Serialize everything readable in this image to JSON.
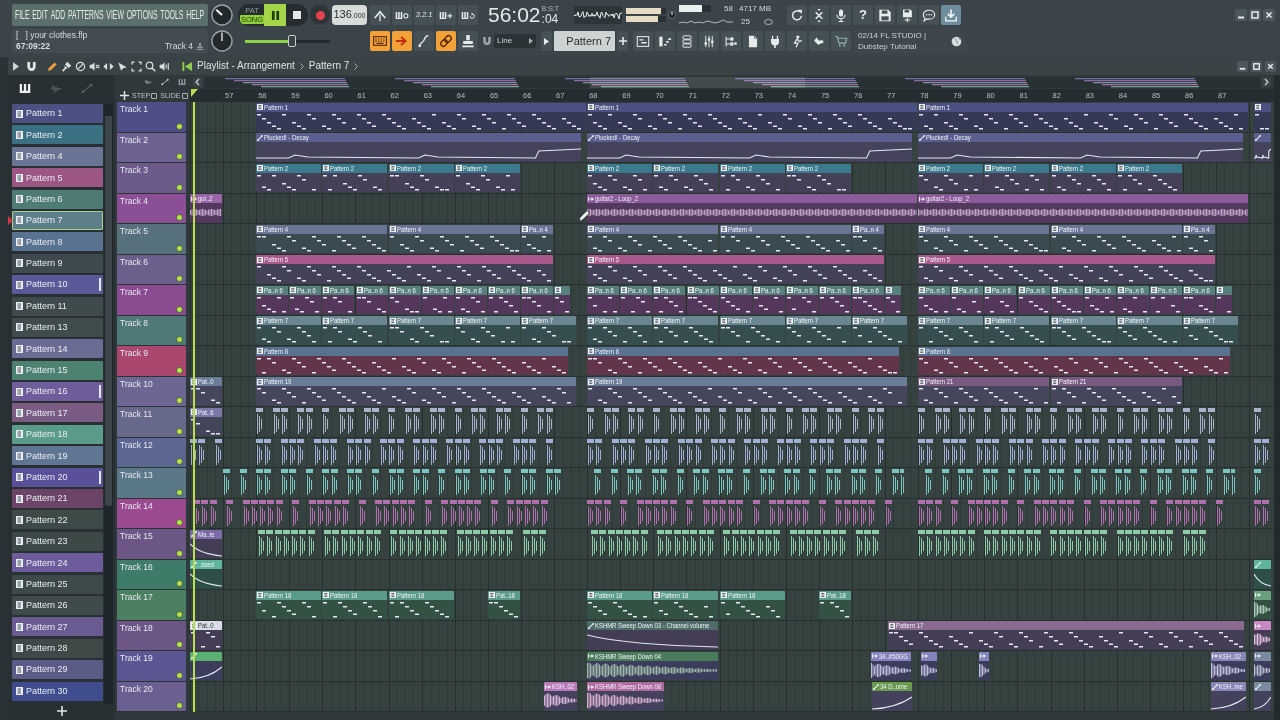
{
  "menu": [
    "FILE",
    "EDIT",
    "ADD",
    "PATTERNS",
    "VIEW",
    "OPTIONS",
    "TOOLS",
    "HELP"
  ],
  "hint": {
    "project": "[   ] your clothes.flp",
    "time": "67:09:22",
    "target": "Track 4"
  },
  "transport": {
    "modes": [
      {
        "label": "PAT",
        "selected": false
      },
      {
        "label": "SONG",
        "selected": true
      }
    ],
    "playing": true,
    "tempo": "136",
    "tempo_fraction": ".000",
    "countdown": "3.2.1"
  },
  "song_position": {
    "time": "56:02",
    "ticks": ":04",
    "unit": "B:S:T"
  },
  "peak_meters": [
    {
      "level": 0.88
    },
    {
      "level": 0.8
    }
  ],
  "cpu": {
    "level": 0.72,
    "value": "58",
    "memory": "4717 MB",
    "polyphony": "25"
  },
  "help": "?",
  "master": {
    "level": 0.55
  },
  "toggles": [
    {
      "on": true
    },
    {
      "on": true
    },
    {
      "on": false
    },
    {
      "on": true
    },
    {
      "on": false
    }
  ],
  "snap": "Line",
  "pattern_selector": "Pattern 7",
  "news": {
    "line_1": "02/14 FL STUDIO |",
    "line_2": "Dubstep Tutorial"
  },
  "playlist": {
    "title": "Playlist - Arrangement",
    "crumb": "Pattern 7",
    "tools": [
      {
        "selected": true
      },
      {
        "selected": false
      },
      {
        "selected": false
      },
      {
        "selected": false
      },
      {
        "selected": false
      },
      {
        "selected": false
      },
      {
        "selected": false
      },
      {
        "selected": false
      },
      {
        "selected": false
      }
    ],
    "options": [
      {
        "label": "STEP",
        "checked": false
      },
      {
        "label": "SLIDE",
        "checked": false
      }
    ]
  },
  "ruler": [
    "57",
    "58",
    "59",
    "60",
    "61",
    "62",
    "63",
    "64",
    "65",
    "66",
    "67",
    "68",
    "69",
    "70",
    "71",
    "72",
    "73",
    "74",
    "75",
    "76",
    "77",
    "78",
    "79",
    "80",
    "81",
    "82",
    "83",
    "84",
    "85",
    "86",
    "87"
  ],
  "patterns": [
    {
      "name": "Pattern 1",
      "color": "#4b5183",
      "selected": false,
      "marked": false
    },
    {
      "name": "Pattern 2",
      "color": "#3a7082",
      "selected": false,
      "marked": false
    },
    {
      "name": "Pattern 4",
      "color": "#6a7596",
      "selected": false,
      "marked": false
    },
    {
      "name": "Pattern 5",
      "color": "#9b5683",
      "selected": false,
      "marked": false
    },
    {
      "name": "Pattern 6",
      "color": "#4f7b76",
      "selected": false,
      "marked": false
    },
    {
      "name": "Pattern 7",
      "color": "#5d7f89",
      "selected": true,
      "marked": false
    },
    {
      "name": "Pattern 8",
      "color": "#587290",
      "selected": false,
      "marked": false
    },
    {
      "name": "Pattern 9",
      "color": "#3e4a4d",
      "selected": false,
      "marked": false
    },
    {
      "name": "Pattern 10",
      "color": "#5a5a98",
      "selected": false,
      "marked": true
    },
    {
      "name": "Pattern 11",
      "color": "#3e4a4b",
      "selected": false,
      "marked": false
    },
    {
      "name": "Pattern 13",
      "color": "#3f4b4c",
      "selected": false,
      "marked": false
    },
    {
      "name": "Pattern 14",
      "color": "#6a6c94",
      "selected": false,
      "marked": false
    },
    {
      "name": "Pattern 15",
      "color": "#4d8270",
      "selected": false,
      "marked": false
    },
    {
      "name": "Pattern 16",
      "color": "#6f5c9a",
      "selected": false,
      "marked": true
    },
    {
      "name": "Pattern 17",
      "color": "#7a5b82",
      "selected": false,
      "marked": false
    },
    {
      "name": "Pattern 18",
      "color": "#5a9b8a",
      "selected": false,
      "marked": false
    },
    {
      "name": "Pattern 19",
      "color": "#607593",
      "selected": false,
      "marked": false
    },
    {
      "name": "Pattern 20",
      "color": "#5a4f99",
      "selected": false,
      "marked": true
    },
    {
      "name": "Pattern 21",
      "color": "#6b4468",
      "selected": false,
      "marked": false
    },
    {
      "name": "Pattern 22",
      "color": "#3e4a48",
      "selected": false,
      "marked": false
    },
    {
      "name": "Pattern 23",
      "color": "#3d4947",
      "selected": false,
      "marked": false
    },
    {
      "name": "Pattern 24",
      "color": "#6c5c9c",
      "selected": false,
      "marked": false
    },
    {
      "name": "Pattern 25",
      "color": "#3e4a49",
      "selected": false,
      "marked": false
    },
    {
      "name": "Pattern 26",
      "color": "#3f4a4a",
      "selected": false,
      "marked": false
    },
    {
      "name": "Pattern 27",
      "color": "#6a5b92",
      "selected": false,
      "marked": false
    },
    {
      "name": "Pattern 28",
      "color": "#3e4948",
      "selected": false,
      "marked": false
    },
    {
      "name": "Pattern 29",
      "color": "#5b5b88",
      "selected": false,
      "marked": false
    },
    {
      "name": "Pattern 30",
      "color": "#3f4d8e",
      "selected": false,
      "marked": false
    }
  ],
  "tracks": [
    {
      "name": "Track 1",
      "color": "#4d4f86",
      "enabled": true,
      "clips": [
        {
          "kind": "pattern",
          "label": "Pattern 1",
          "color": "#4b5183"
        },
        {
          "kind": "pattern",
          "label": "Pattern 1",
          "color": "#4b5183"
        },
        {
          "kind": "pattern",
          "label": "Pattern 1",
          "color": "#4b5183"
        },
        {
          "kind": "pattern",
          "color": "#4b5183"
        }
      ]
    },
    {
      "name": "Track 2",
      "color": "#6d6292",
      "enabled": true,
      "clips": [
        {
          "kind": "automation",
          "label": "Plucked! - Decay",
          "color": "#5b5f8f"
        },
        {
          "kind": "automation",
          "label": "Plucked! - Decay",
          "color": "#5b5f8f"
        },
        {
          "kind": "automation",
          "label": "Plucked! - Decay",
          "color": "#5b5f8f"
        },
        {
          "kind": "automation",
          "color": "#5b5f8f"
        }
      ]
    },
    {
      "name": "Track 3",
      "color": "#6c5a8a",
      "enabled": true,
      "clips": [
        {
          "kind": "pattern",
          "label": "Pattern 2",
          "color": "#3a7a8c"
        },
        {
          "kind": "pattern",
          "label": "Pattern 2",
          "color": "#3a7a8c"
        },
        {
          "kind": "pattern",
          "label": "Pattern 2",
          "color": "#3a7a8c"
        },
        {
          "kind": "pattern",
          "label": "Pattern 2",
          "color": "#3a7a8c"
        },
        {
          "kind": "pattern",
          "label": "Pattern 2",
          "color": "#3a7a8c"
        },
        {
          "kind": "pattern",
          "label": "Pattern 2",
          "color": "#3a7a8c"
        },
        {
          "kind": "pattern",
          "label": "Pattern 2",
          "color": "#3a7a8c"
        },
        {
          "kind": "pattern",
          "label": "Pattern 2",
          "color": "#3a7a8c"
        },
        {
          "kind": "pattern",
          "label": "Pattern 2",
          "color": "#3a7a8c"
        },
        {
          "kind": "pattern",
          "label": "Pattern 2",
          "color": "#3a7a8c"
        },
        {
          "kind": "pattern",
          "label": "Pattern 2",
          "color": "#3a7a8c"
        },
        {
          "kind": "pattern",
          "label": "Pattern 2",
          "color": "#3a7a8c"
        }
      ]
    },
    {
      "name": "Track 4",
      "color": "#8b4f96",
      "enabled": true,
      "clips": [
        {
          "kind": "audio",
          "label": "gui..2",
          "color": "#9a64a8"
        },
        {
          "kind": "audio",
          "label": "guitar2 - Loop_2",
          "color": "#8a5a9a"
        },
        {
          "kind": "audio",
          "label": "guitar2 - Loop_2",
          "color": "#8a5a9a"
        }
      ]
    },
    {
      "name": "Track 5",
      "color": "#56717b",
      "enabled": true,
      "clips": [
        {
          "kind": "pattern",
          "label": "Pattern 4",
          "color": "#6a7596"
        },
        {
          "kind": "pattern",
          "label": "Pattern 4",
          "color": "#6a7596"
        },
        {
          "kind": "pattern",
          "label": "Pa..n 4",
          "color": "#6a7596"
        },
        {
          "kind": "pattern",
          "label": "Pattern 4",
          "color": "#6a7596"
        },
        {
          "kind": "pattern",
          "label": "Pattern 4",
          "color": "#6a7596"
        },
        {
          "kind": "pattern",
          "label": "Pa..n 4",
          "color": "#6a7596"
        },
        {
          "kind": "pattern",
          "label": "Pattern 4",
          "color": "#6a7596"
        },
        {
          "kind": "pattern",
          "label": "Pattern 4",
          "color": "#6a7596"
        },
        {
          "kind": "pattern",
          "label": "Pa..n 4",
          "color": "#6a7596"
        }
      ]
    },
    {
      "name": "Track 6",
      "color": "#6b608c",
      "enabled": true,
      "clips": [
        {
          "kind": "pattern",
          "label": "Pattern 5",
          "color": "#a8588a"
        },
        {
          "kind": "pattern",
          "label": "Pattern 5",
          "color": "#a8588a"
        },
        {
          "kind": "pattern",
          "label": "Pattern 5",
          "color": "#a8588a"
        }
      ]
    },
    {
      "name": "Track 7",
      "color": "#8b4b90",
      "enabled": true,
      "clips": [
        {
          "kind": "pattern",
          "label": "Pa..n 6",
          "color": "#57807c"
        },
        {
          "kind": "pattern",
          "label": "Pa..n 6",
          "color": "#57807c"
        },
        {
          "kind": "pattern",
          "label": "Pa..n 6",
          "color": "#57807c"
        },
        {
          "kind": "pattern",
          "label": "Pa..n 6",
          "color": "#57807c"
        },
        {
          "kind": "pattern",
          "label": "Pa..n 6",
          "color": "#57807c"
        },
        {
          "kind": "pattern",
          "label": "Pa..n 6",
          "color": "#57807c"
        },
        {
          "kind": "pattern",
          "label": "Pa..n 6",
          "color": "#57807c"
        },
        {
          "kind": "pattern",
          "label": "Pa..n 6",
          "color": "#57807c"
        },
        {
          "kind": "pattern",
          "label": "Pa..n 6",
          "color": "#57807c"
        },
        {
          "kind": "pattern",
          "color": "#57807c"
        },
        {
          "kind": "pattern",
          "label": "Pa..n 6",
          "color": "#57807c"
        },
        {
          "kind": "pattern",
          "label": "Pa..n 6",
          "color": "#57807c"
        },
        {
          "kind": "pattern",
          "label": "Pa..n 6",
          "color": "#57807c"
        },
        {
          "kind": "pattern",
          "label": "Pa..n 6",
          "color": "#57807c"
        },
        {
          "kind": "pattern",
          "label": "Pa..n 6",
          "color": "#57807c"
        },
        {
          "kind": "pattern",
          "label": "Pa..n 6",
          "color": "#57807c"
        },
        {
          "kind": "pattern",
          "label": "Pa..n 6",
          "color": "#57807c"
        },
        {
          "kind": "pattern",
          "label": "Pa..n 6",
          "color": "#57807c"
        },
        {
          "kind": "pattern",
          "label": "Pa..n 6",
          "color": "#57807c"
        },
        {
          "kind": "pattern",
          "color": "#57807c"
        },
        {
          "kind": "pattern",
          "label": "Pa..n 6",
          "color": "#57807c"
        },
        {
          "kind": "pattern",
          "label": "Pa..n 6",
          "color": "#57807c"
        },
        {
          "kind": "pattern",
          "label": "Pa..n 6",
          "color": "#57807c"
        },
        {
          "kind": "pattern",
          "label": "Pa..n 6",
          "color": "#57807c"
        },
        {
          "kind": "pattern",
          "label": "Pa..n 6",
          "color": "#57807c"
        },
        {
          "kind": "pattern",
          "label": "Pa..n 6",
          "color": "#57807c"
        },
        {
          "kind": "pattern",
          "label": "Pa..n 6",
          "color": "#57807c"
        },
        {
          "kind": "pattern",
          "label": "Pa..n 6",
          "color": "#57807c"
        },
        {
          "kind": "pattern",
          "label": "Pa..n 6",
          "color": "#57807c"
        },
        {
          "kind": "pattern",
          "color": "#57807c"
        }
      ]
    },
    {
      "name": "Track 8",
      "color": "#4f7878",
      "enabled": true,
      "clips": [
        {
          "kind": "pattern",
          "label": "Pattern 7",
          "color": "#6a8690"
        },
        {
          "kind": "pattern",
          "label": "Pattern 7",
          "color": "#6a8690"
        },
        {
          "kind": "pattern",
          "label": "Pattern 7",
          "color": "#6a8690"
        },
        {
          "kind": "pattern",
          "label": "Pattern 7",
          "color": "#6a8690"
        },
        {
          "kind": "pattern",
          "label": "Pattern 7",
          "color": "#6a8690"
        },
        {
          "kind": "pattern",
          "label": "Pattern 7",
          "color": "#6a8690"
        },
        {
          "kind": "pattern",
          "label": "Pattern 7",
          "color": "#6a8690"
        },
        {
          "kind": "pattern",
          "label": "Pattern 7",
          "color": "#6a8690"
        },
        {
          "kind": "pattern",
          "label": "Pattern 7",
          "color": "#6a8690"
        },
        {
          "kind": "pattern",
          "label": "Pattern 7",
          "color": "#6a8690"
        },
        {
          "kind": "pattern",
          "label": "Pattern 7",
          "color": "#6a8690"
        },
        {
          "kind": "pattern",
          "label": "Pattern 7",
          "color": "#6a8690"
        },
        {
          "kind": "pattern",
          "label": "Pattern 7",
          "color": "#6a8690"
        },
        {
          "kind": "pattern",
          "label": "Pattern 7",
          "color": "#6a8690"
        },
        {
          "kind": "pattern",
          "label": "Pattern 7",
          "color": "#6a8690"
        }
      ]
    },
    {
      "name": "Track 9",
      "color": "#a9476f",
      "enabled": true,
      "clips": [
        {
          "kind": "pattern",
          "label": "Pattern 8",
          "color": "#587290"
        },
        {
          "kind": "pattern",
          "label": "Pattern 8",
          "color": "#587290"
        },
        {
          "kind": "pattern",
          "label": "Pattern 8",
          "color": "#587290"
        }
      ]
    },
    {
      "name": "Track 10",
      "color": "#6d6692",
      "enabled": true,
      "clips": [
        {
          "kind": "pattern",
          "label": "Pat..0",
          "color": "#6a7d98"
        },
        {
          "kind": "pattern",
          "label": "Pattern 19",
          "color": "#6a7d98"
        },
        {
          "kind": "pattern",
          "label": "Pattern 19",
          "color": "#6a7d98"
        },
        {
          "kind": "pattern",
          "label": "Pattern 21",
          "color": "#7a5a82"
        },
        {
          "kind": "pattern",
          "label": "Pattern 21",
          "color": "#7a5a82"
        }
      ]
    },
    {
      "name": "Track 11",
      "color": "#67698b",
      "enabled": true,
      "clips": [
        {
          "kind": "pattern",
          "label": "Pat..6",
          "color": "#7a76a8"
        },
        {
          "kind": "hits",
          "color": "#a8b4cc"
        },
        {
          "kind": "hits",
          "color": "#a8b4cc"
        },
        {
          "kind": "hits",
          "color": "#a8b4cc"
        },
        {
          "kind": "hits",
          "color": "#a8b4cc"
        }
      ]
    },
    {
      "name": "Track 12",
      "color": "#5b6792",
      "enabled": true,
      "clips": [
        {
          "kind": "hits",
          "color": "#9fb0d4"
        },
        {
          "kind": "hits",
          "color": "#9fb0d4"
        },
        {
          "kind": "hits",
          "color": "#9fb0d4"
        },
        {
          "kind": "hits",
          "color": "#9fb0d4"
        },
        {
          "kind": "hits",
          "color": "#9fb0d4"
        }
      ]
    },
    {
      "name": "Track 13",
      "color": "#5a7888",
      "enabled": true,
      "clips": [
        {
          "kind": "hits",
          "color": "#7cc4c0"
        },
        {
          "kind": "hits",
          "color": "#7cc4c0"
        },
        {
          "kind": "hits",
          "color": "#7cc4c0"
        },
        {
          "kind": "hits",
          "color": "#7cc4c0"
        }
      ]
    },
    {
      "name": "Track 14",
      "color": "#9b4a90",
      "enabled": true,
      "clips": [
        {
          "kind": "hits",
          "color": "#b070b0"
        },
        {
          "kind": "hits",
          "color": "#b070b0"
        },
        {
          "kind": "hits",
          "color": "#b070b0"
        },
        {
          "kind": "hits",
          "color": "#b070b0"
        }
      ]
    },
    {
      "name": "Track 15",
      "color": "#6b5686",
      "enabled": true,
      "clips": [
        {
          "kind": "automation",
          "label": "Ma..te",
          "color": "#7a6aa8"
        },
        {
          "kind": "hits",
          "color": "#8ccaa8"
        },
        {
          "kind": "hits",
          "color": "#8ccaa8"
        },
        {
          "kind": "hits",
          "color": "#8ccaa8"
        }
      ]
    },
    {
      "name": "Track 16",
      "color": "#3e7b69",
      "enabled": true,
      "clips": [
        {
          "kind": "automation",
          "label": "..ssed",
          "color": "#5fb59c"
        },
        {
          "kind": "automation",
          "color": "#5fb59c"
        }
      ]
    },
    {
      "name": "Track 17",
      "color": "#4b8162",
      "enabled": true,
      "clips": [
        {
          "kind": "pattern",
          "label": "Pattern 18",
          "color": "#5a9b8a"
        },
        {
          "kind": "pattern",
          "label": "Pattern 18",
          "color": "#5a9b8a"
        },
        {
          "kind": "pattern",
          "label": "Pattern 18",
          "color": "#5a9b8a"
        },
        {
          "kind": "pattern",
          "label": "Pat..18",
          "color": "#5a9b8a"
        },
        {
          "kind": "pattern",
          "label": "Pattern 18",
          "color": "#5a9b8a"
        },
        {
          "kind": "pattern",
          "label": "Pattern 18",
          "color": "#5a9b8a"
        },
        {
          "kind": "pattern",
          "label": "Pattern 18",
          "color": "#5a9b8a"
        },
        {
          "kind": "pattern",
          "label": "Pat..18",
          "color": "#5a9b8a"
        },
        {
          "kind": "audio",
          "color": "#6aa080"
        }
      ]
    },
    {
      "name": "Track 18",
      "color": "#6b5686",
      "enabled": true,
      "clips": [
        {
          "kind": "pattern",
          "label": "Pat..0",
          "color": "#d8dce4"
        },
        {
          "kind": "automation",
          "label": "KSHMR Sweep Down 03 - Channel volume",
          "color": "#4f6c68"
        },
        {
          "kind": "pattern",
          "label": "Pattern 17",
          "color": "#8a6a90"
        },
        {
          "kind": "audio",
          "color": "#c888c0"
        }
      ]
    },
    {
      "name": "Track 19",
      "color": "#5b5692",
      "enabled": true,
      "clips": [
        {
          "kind": "automation",
          "color": "#5ab070"
        },
        {
          "kind": "audio",
          "label": "KSHMR Sweep Down 04",
          "color": "#4a7c5c"
        },
        {
          "kind": "audio",
          "label": "34..#50GG",
          "color": "#8684bc"
        },
        {
          "kind": "audio",
          "color": "#8684bc"
        },
        {
          "kind": "audio",
          "color": "#8684bc"
        },
        {
          "kind": "audio",
          "label": "KSH..02",
          "color": "#8a86b8"
        },
        {
          "kind": "audio",
          "color": "#7a8aa0"
        }
      ]
    },
    {
      "name": "Track 20",
      "color": "#6b5f92",
      "enabled": true,
      "clips": [
        {
          "kind": "audio",
          "label": "KSH..02",
          "color": "#b87abb"
        },
        {
          "kind": "audio",
          "label": "KSHMR Sweep Down 08",
          "color": "#b06aa2"
        },
        {
          "kind": "automation",
          "label": "34 D..ume",
          "color": "#6a9a50"
        },
        {
          "kind": "automation",
          "label": "KSH..me",
          "color": "#8a86b8"
        },
        {
          "kind": "automation",
          "color": "#7a8aa0"
        }
      ]
    }
  ]
}
